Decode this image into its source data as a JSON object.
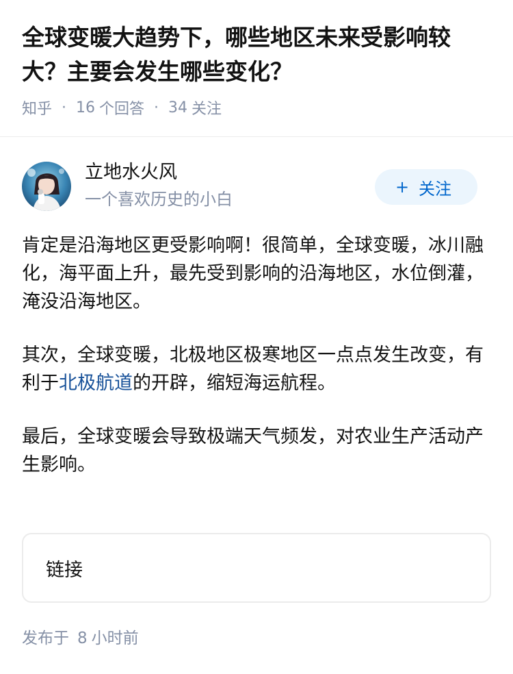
{
  "question": {
    "title": "全球变暖大趋势下，哪些地区未来受影响较大？主要会发生哪些变化？",
    "source": "知乎",
    "answer_count": "16",
    "answer_suffix": "个回答",
    "follower_count": "34",
    "follower_suffix": "关注",
    "separator": "·"
  },
  "author": {
    "name": "立地水火风",
    "bio": "一个喜欢历史的小白",
    "follow_icon": "+",
    "follow_label": "关注",
    "avatar_icon": "user-avatar"
  },
  "answer": {
    "p1": "肯定是沿海地区更受影响啊！很简单，全球变暖，冰川融化，海平面上升，最先受到影响的沿海地区，水位倒灌，淹没沿海地区。",
    "p2_before": "其次，全球变暖，北极地区极寒地区一点点发生改变，有利于",
    "p2_link": "北极航道",
    "p2_after": "的开辟，缩短海运航程。",
    "p3": "最后，全球变暖会导致极端天气频发，对农业生产活动产生影响。"
  },
  "link_card": {
    "label": "链接"
  },
  "publish": {
    "prefix": "发布于",
    "number": "8",
    "suffix": "小时前"
  },
  "colors": {
    "meta_gray": "#8590a6",
    "link_blue": "#175199",
    "follow_bg": "#ebf5fd",
    "follow_text": "#0066cc"
  }
}
